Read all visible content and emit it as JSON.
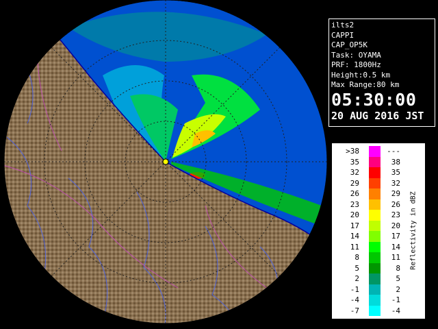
{
  "info": {
    "product_id": "ilts2",
    "product_type": "CAPPI",
    "product_code": "CAP_OP5K",
    "task": "Task: OYAMA",
    "prf": "PRF: 1800Hz",
    "height": "Height:0.5 km",
    "max_range": "Max Range:80 km",
    "time": "05:30:00",
    "date": "20 AUG 2016 JST"
  },
  "legend": {
    "title": "Reflectivity in dBZ",
    "rows": [
      {
        "lo": ">38",
        "hi": "---",
        "color": "#ff00ff"
      },
      {
        "lo": "35",
        "hi": "38",
        "color": "#ff0080"
      },
      {
        "lo": "32",
        "hi": "35",
        "color": "#ff0000"
      },
      {
        "lo": "29",
        "hi": "32",
        "color": "#ff4000"
      },
      {
        "lo": "26",
        "hi": "29",
        "color": "#ff8000"
      },
      {
        "lo": "23",
        "hi": "26",
        "color": "#ffc000"
      },
      {
        "lo": "20",
        "hi": "23",
        "color": "#ffff00"
      },
      {
        "lo": "17",
        "hi": "20",
        "color": "#c0ff00"
      },
      {
        "lo": "14",
        "hi": "17",
        "color": "#80ff00"
      },
      {
        "lo": "11",
        "hi": "14",
        "color": "#00ff00"
      },
      {
        "lo": "8",
        "hi": "11",
        "color": "#00c800"
      },
      {
        "lo": "5",
        "hi": "8",
        "color": "#009600"
      },
      {
        "lo": "2",
        "hi": "5",
        "color": "#009664"
      },
      {
        "lo": "-1",
        "hi": "2",
        "color": "#00b4b4"
      },
      {
        "lo": "-4",
        "hi": "-1",
        "color": "#00dcdc"
      },
      {
        "lo": "-7",
        "hi": "-4",
        "color": "#00ffff"
      }
    ]
  }
}
